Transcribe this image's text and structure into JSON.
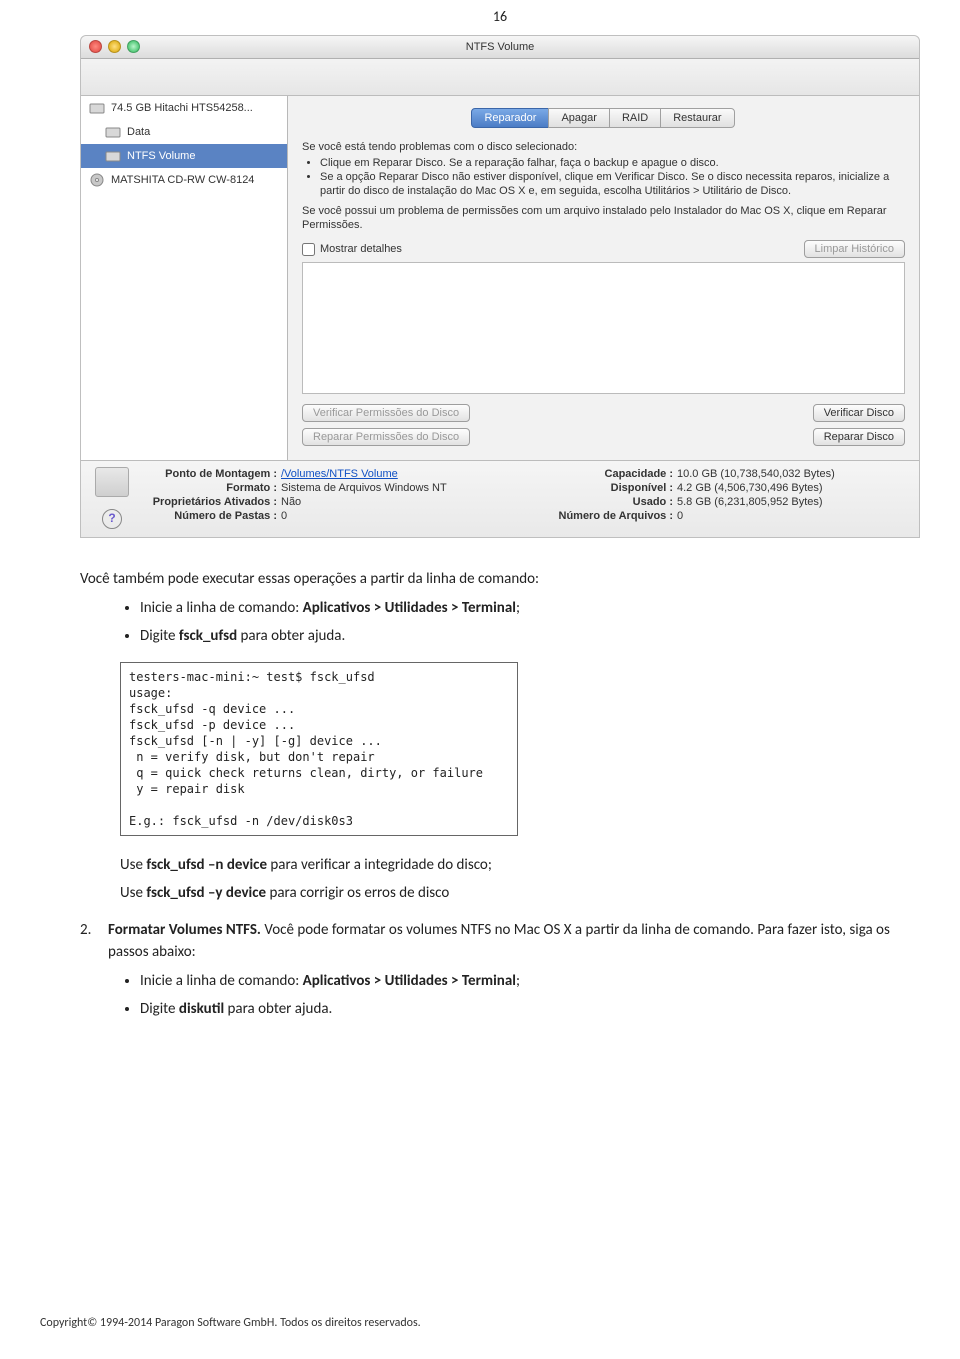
{
  "page_number": "16",
  "window": {
    "title": "NTFS Volume",
    "sidebar": [
      {
        "label": "74.5 GB Hitachi HTS54258...",
        "sel": false,
        "icon": "disk"
      },
      {
        "label": "Data",
        "sel": false,
        "icon": "vol"
      },
      {
        "label": "NTFS Volume",
        "sel": true,
        "icon": "vol"
      },
      {
        "label": "MATSHITA CD-RW CW-8124",
        "sel": false,
        "icon": "cd"
      }
    ],
    "tabs": [
      {
        "label": "Reparador",
        "active": true
      },
      {
        "label": "Apagar",
        "active": false
      },
      {
        "label": "RAID",
        "active": false
      },
      {
        "label": "Restaurar",
        "active": false
      }
    ],
    "intro_lead": "Se você está tendo problemas com o disco selecionado:",
    "intro_bullets": [
      "Clique em Reparar Disco. Se a reparação falhar, faça o backup e apague o disco.",
      "Se a opção Reparar Disco não estiver disponível, clique em Verificar Disco. Se o disco necessita reparos, inicialize a partir do disco de instalação do Mac OS X e, em seguida, escolha Utilitários > Utilitário de Disco."
    ],
    "intro_second": "Se você possui um problema de permissões com um arquivo instalado pelo Instalador do Mac OS X, clique em Reparar Permissões.",
    "show_details": "Mostrar detalhes",
    "clear_history": "Limpar Histórico",
    "btn_verify_perm": "Verificar Permissões do Disco",
    "btn_repair_perm": "Reparar Permissões do Disco",
    "btn_verify_disk": "Verificar Disco",
    "btn_repair_disk": "Reparar Disco",
    "info_left": [
      {
        "label": "Ponto de Montagem :",
        "value": "/Volumes/NTFS Volume",
        "link": true
      },
      {
        "label": "Formato :",
        "value": "Sistema de Arquivos Windows NT"
      },
      {
        "label": "Proprietários Ativados :",
        "value": "Não"
      },
      {
        "label": "Número de Pastas :",
        "value": "0"
      }
    ],
    "info_right": [
      {
        "label": "Capacidade :",
        "value": "10.0 GB (10,738,540,032 Bytes)"
      },
      {
        "label": "Disponível :",
        "value": "4.2 GB (4,506,730,496 Bytes)"
      },
      {
        "label": "Usado :",
        "value": "5.8 GB (6,231,805,952 Bytes)"
      },
      {
        "label": "Número de Arquivos :",
        "value": "0"
      }
    ]
  },
  "doc": {
    "p1": "Você também pode executar essas operações a partir da linha de comando:",
    "li1_prefix": "Inicie a linha de comando: ",
    "li1_b": "Aplicativos > Utilidades > Terminal",
    "li1_suffix": ";",
    "li2_prefix": "Digite ",
    "li2_b": "fsck_ufsd",
    "li2_suffix": " para obter ajuda.",
    "terminal": "testers-mac-mini:~ test$ fsck_ufsd\nusage:\nfsck_ufsd -q device ...\nfsck_ufsd -p device ...\nfsck_ufsd [-n | -y] [-g] device ...\n n = verify disk, but don't repair\n q = quick check returns clean, dirty, or failure\n y = repair disk\n\nE.g.: fsck_ufsd -n /dev/disk0s3",
    "use1_prefix": "Use ",
    "use1_b": "fsck_ufsd –n device",
    "use1_suffix": " para verificar a integridade do disco;",
    "use2_prefix": "Use ",
    "use2_b": "fsck_ufsd –y device",
    "use2_suffix": " para corrigir os erros de disco",
    "item2_num": "2.",
    "item2_b": "Formatar Volumes NTFS.",
    "item2_text": " Você pode formatar os volumes NTFS no Mac OS X a partir da linha de comando. Para fazer isto, siga os passos abaixo:",
    "li3_prefix": "Inicie a linha de comando: ",
    "li3_b": "Aplicativos > Utilidades > Terminal",
    "li3_suffix": ";",
    "li4_prefix": "Digite ",
    "li4_b": "diskutil",
    "li4_suffix": " para obter ajuda."
  },
  "copyright": "Copyright© 1994-2014 Paragon Software GmbH. Todos os direitos reservados."
}
